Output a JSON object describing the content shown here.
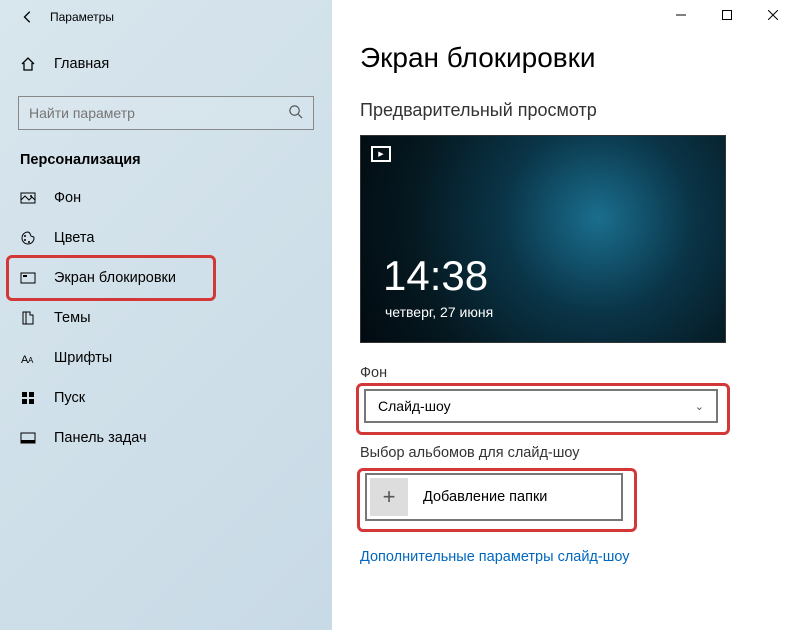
{
  "titlebar": {
    "title": "Параметры"
  },
  "sidebar": {
    "home": "Главная",
    "search_placeholder": "Найти параметр",
    "category": "Персонализация",
    "items": [
      {
        "label": "Фон"
      },
      {
        "label": "Цвета"
      },
      {
        "label": "Экран блокировки"
      },
      {
        "label": "Темы"
      },
      {
        "label": "Шрифты"
      },
      {
        "label": "Пуск"
      },
      {
        "label": "Панель задач"
      }
    ]
  },
  "main": {
    "heading": "Экран блокировки",
    "preview_label": "Предварительный просмотр",
    "preview": {
      "time": "14:38",
      "date": "четверг, 27 июня"
    },
    "background_label": "Фон",
    "background_value": "Слайд-шоу",
    "album_label": "Выбор альбомов для слайд-шоу",
    "add_folder": "Добавление папки",
    "more_link": "Дополнительные параметры слайд-шоу"
  }
}
